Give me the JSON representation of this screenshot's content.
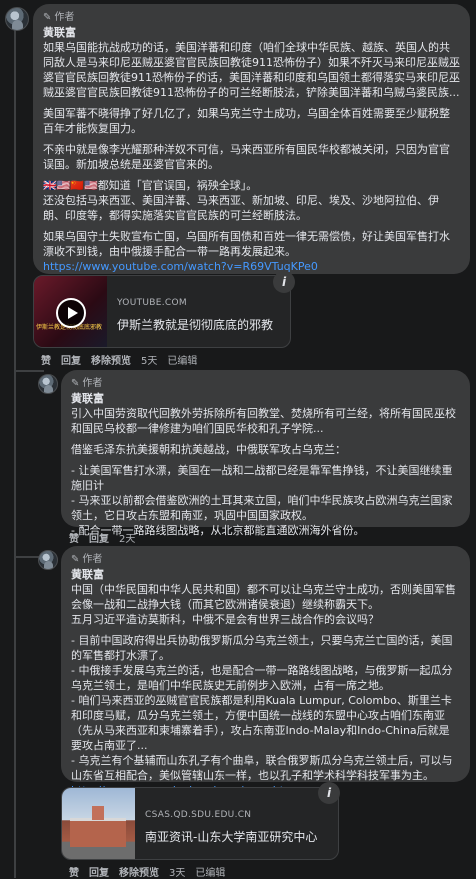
{
  "comments": [
    {
      "badge": "作者",
      "author": "黄联富",
      "paragraphs": [
        "如果乌国能抗战成功的话，美国洋蕃和印度（咱们全球中华民族、越族、英国人的共同敌人是马来印尼巫贼巫婆官官民族回教徒911恐怖份子）如果不歼灭马来印尼巫贼巫婆官官民族回教徒911恐怖份子的话，美国洋蕃和印度和乌国领土都得落实马来印尼巫贼巫婆官官民族回教徒911恐怖份子的可兰经断肢法，铲除美国洋蕃和乌贼乌婆民族...",
        "美国军蕃不晓得挣了好几亿了，如果乌克兰守土成功，乌国全体百姓需要至少赋税整百年才能恢复国力。",
        "不亲中就是像李光耀那种洋奴不可信，马来西亚所有国民华校都被关闭，只因为官官误国。新加坡总统是巫婆官官来的。",
        "都知道「官官误国，祸殃全球」。",
        "还没包括马来西亚、美国洋蕃、马来西亚、新加坡、印尼、埃及、沙地阿拉伯、伊朗、印度等，都得实施落实官官民族的可兰经断肢法。",
        "如果乌国守土失败宣布亡国，乌国所有国债和百姓一律无需偿债，好让美国军售打水漂收不到钱，由中俄援手配合一带一路再发展起来。"
      ],
      "flags": "🇬🇧🇺🇸🇨🇳🇺🇸",
      "link": "https://www.youtube.com/watch?v=R69VTuqKPe0",
      "card": {
        "domain": "YOUTUBE.COM",
        "title": "伊斯兰教就是彻彻底底的邪教",
        "thumb_text": "伊斯兰教是彻彻底底邪教"
      },
      "actions": {
        "like": "赞",
        "reply": "回复",
        "preview": "移除预览",
        "time": "5天",
        "edited": "已编辑"
      }
    },
    {
      "badge": "作者",
      "author": "黄联富",
      "paragraphs": [
        "引入中国劳资取代回教外劳拆除所有回教堂、焚烧所有可兰经，将所有国民巫校和国民乌校都一律修建为咱们国民华校和孔子学院...",
        "借鉴毛泽东抗美援朝和抗美越战，中俄联军攻占乌克兰：",
        "- 让美国军售打水漂，美国在一战和二战都已经是靠军售挣钱，不让美国继续重施旧计",
        "- 马来亚以前都会借鉴欧洲的土耳其来立国，咱们中华民族攻占欧洲乌克兰国家领土，它日攻占东盟和南亚，巩固中国国家政权。",
        "- 配合一带一路路线图战略，从北京都能直通欧洲海外省份。"
      ],
      "actions": {
        "like": "赞",
        "reply": "回复",
        "time": "2天"
      }
    },
    {
      "badge": "作者",
      "author": "黄联富",
      "paragraphs": [
        "中国（中华民国和中华人民共和国）都不可以让乌克兰守土成功，否则美国军售会像一战和二战挣大钱（而其它欧洲诸侯衰退）继续称霸天下。",
        "五月习近平造访莫斯科，中俄不是会有世界三战合作的会议吗？",
        "- 目前中国政府得出兵协助俄罗斯瓜分乌克兰领土，只要乌克兰亡国的话，美国的军售都打水漂了。",
        "- 中俄接手发展乌克兰的话，也是配合一带一路路线图战略，与俄罗斯一起瓜分乌克兰领土，是咱们中华民族史无前例步入欧洲，占有一席之地。",
        "- 咱们马来西亚的巫贼官官民族都是利用Kuala Lumpur, Colombo、斯里兰卡和印度马赋，瓜分乌克兰领土，方便中国统一战线的东盟中心攻占咱们东南亚（先从马来西亚和柬埔寨着手），攻占东南亚Indo-Malay和Indo-China后就是要攻占南亚了...",
        "- 乌克兰有个基辅而山东孔子有个曲阜，联合俄罗斯瓜分乌克兰领土后，可以与山东省互相配合，美似管辖山东一样，也以孔子和学术科学科技军事为主。"
      ],
      "link": "http://www.csas.qd.sdu.edu.cn/nyzx.htm",
      "card": {
        "domain": "CSAS.QD.SDU.EDU.CN",
        "title": "南亚资讯-山东大学南亚研究中心"
      },
      "actions": {
        "like": "赞",
        "reply": "回复",
        "preview": "移除预览",
        "time": "3天",
        "edited": "已编辑"
      }
    }
  ],
  "colors": {
    "background": "#18191a",
    "bubble": "#3a3b3c",
    "link": "#4599ff",
    "muted_text": "#b0b3b8"
  }
}
